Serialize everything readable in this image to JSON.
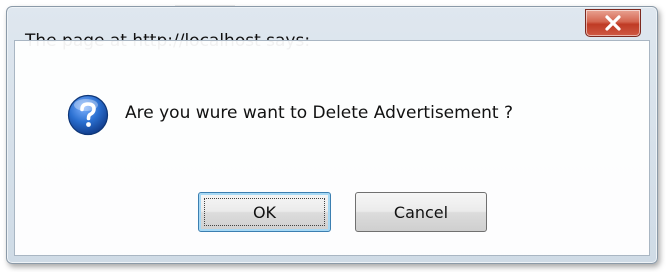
{
  "dialog": {
    "title": "The page at http://localhost says:",
    "message": "Are you wure want to Delete Advertisement ?",
    "icon": "question-icon",
    "close_icon": "close-icon"
  },
  "buttons": {
    "ok_label": "OK",
    "cancel_label": "Cancel"
  },
  "colors": {
    "close_button": "#c8452f",
    "question_icon": "#1f5fb5",
    "default_button_border": "#3c7fb1"
  }
}
